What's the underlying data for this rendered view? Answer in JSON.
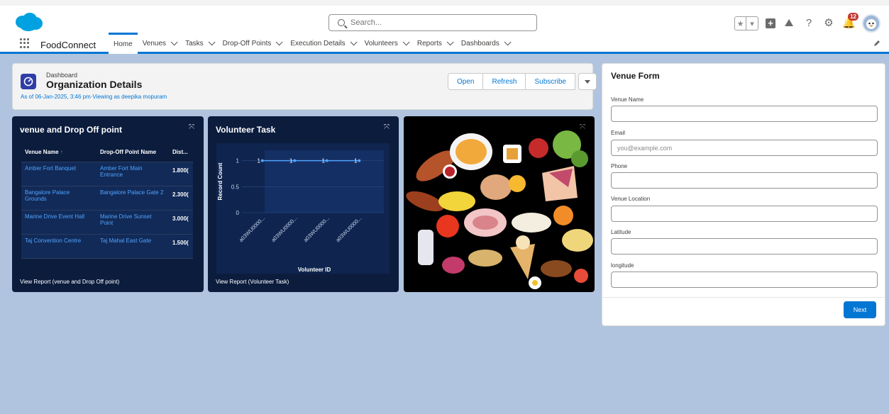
{
  "header": {
    "search_placeholder": "Search...",
    "notification_count": "12"
  },
  "nav": {
    "app_name": "FoodConnect",
    "tabs": [
      {
        "label": "Home",
        "active": true,
        "dropdown": false
      },
      {
        "label": "Venues",
        "dropdown": true
      },
      {
        "label": "Tasks",
        "dropdown": true
      },
      {
        "label": "Drop-Off Points",
        "dropdown": true
      },
      {
        "label": "Execution Details",
        "dropdown": true
      },
      {
        "label": "Volunteers",
        "dropdown": true
      },
      {
        "label": "Reports",
        "dropdown": true
      },
      {
        "label": "Dashboards",
        "dropdown": true
      }
    ]
  },
  "dashboard": {
    "type_label": "Dashboard",
    "title": "Organization Details",
    "as_of": "As of 06-Jan-2025, 3:46 pm·Viewing as deepika mopuram",
    "buttons": {
      "open": "Open",
      "refresh": "Refresh",
      "subscribe": "Subscribe"
    }
  },
  "venue_card": {
    "title": "venue and Drop Off point",
    "columns": [
      "Venue Name",
      "Drop-Off Point Name",
      "Dist..."
    ],
    "rows": [
      [
        "Amber Fort Banquet",
        "Amber Fort Main Entrance",
        "1.800("
      ],
      [
        "Bangalore Palace Grounds",
        "Bangalore Palace Gate 2",
        "2.300("
      ],
      [
        "Marine Drive Event Hall",
        "Marine Drive Sunset Point",
        "3.000("
      ],
      [
        "Taj Convention Centre",
        "Taj Mahal East Gate",
        "1.500("
      ]
    ],
    "footer": "View Report (venue and Drop Off point)"
  },
  "volunteer_card": {
    "title": "Volunteer Task",
    "footer": "View Report (Volunteer Task)"
  },
  "chart_data": {
    "type": "line",
    "title": "Volunteer Task",
    "xlabel": "Volunteer ID",
    "ylabel": "Record Count",
    "categories": [
      "a03WU0000...",
      "a03WU0000...",
      "a03WU0000...",
      "a03WU0000..."
    ],
    "series": [
      {
        "values": [
          1,
          1,
          1,
          1
        ]
      }
    ],
    "data_labels": [
      "1",
      "1",
      "1",
      "1"
    ],
    "yticks": [
      "0",
      "0.5",
      "1"
    ],
    "ylim": [
      0,
      1.2
    ],
    "color": "#4fa3ff"
  },
  "form": {
    "title": "Venue Form",
    "fields": [
      {
        "label": "Venue Name",
        "value": "",
        "placeholder": ""
      },
      {
        "label": "Email",
        "value": "",
        "placeholder": "you@example.com"
      },
      {
        "label": "Phone",
        "value": "",
        "placeholder": ""
      },
      {
        "label": "Venue Location",
        "value": "",
        "placeholder": ""
      },
      {
        "label": "Latitude",
        "value": "",
        "placeholder": ""
      },
      {
        "label": "longitude",
        "value": "",
        "placeholder": ""
      }
    ],
    "next_label": "Next"
  },
  "colors": {
    "brand": "#0176d3",
    "card_bg": "#0b1c3d",
    "page_bg": "#b0c4df"
  }
}
